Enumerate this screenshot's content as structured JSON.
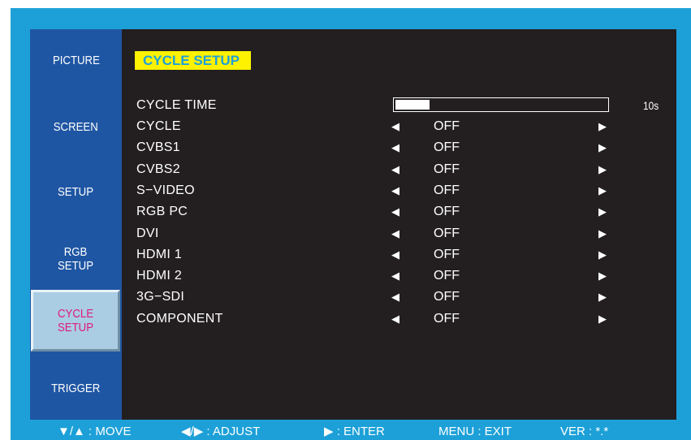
{
  "sidebar": {
    "items": [
      {
        "label": "PICTURE"
      },
      {
        "label": "SCREEN"
      },
      {
        "label": "SETUP"
      },
      {
        "label": "RGB\nSETUP"
      },
      {
        "label": "CYCLE\nSETUP",
        "active": true
      },
      {
        "label": "TRIGGER"
      }
    ]
  },
  "main": {
    "title": "CYCLE SETUP",
    "cycle_time": {
      "label": "CYCLE TIME",
      "value": "10s",
      "level_fraction": 0.16
    },
    "rows": [
      {
        "label": "CYCLE",
        "value": "OFF"
      },
      {
        "label": "CVBS1",
        "value": "OFF"
      },
      {
        "label": "CVBS2",
        "value": "OFF"
      },
      {
        "label": "S−VIDEO",
        "value": "OFF"
      },
      {
        "label": "RGB PC",
        "value": "OFF"
      },
      {
        "label": "DVI",
        "value": "OFF"
      },
      {
        "label": "HDMI 1",
        "value": "OFF"
      },
      {
        "label": "HDMI 2",
        "value": "OFF"
      },
      {
        "label": "3G−SDI",
        "value": "OFF"
      },
      {
        "label": "COMPONENT",
        "value": "OFF"
      }
    ],
    "arrow_left": "◀",
    "arrow_right": "▶"
  },
  "footer": {
    "move": "▼/▲ : MOVE",
    "adjust": "◀/▶ : ADJUST",
    "enter": "▶ : ENTER",
    "exit": "MENU : EXIT",
    "version": "VER : *.*"
  },
  "colors": {
    "frame": "#1da0d8",
    "sidebar": "#1f56a3",
    "content_bg": "#231f20",
    "title_bg": "#fff200",
    "active_item_bg": "#aacde3",
    "active_item_text": "#e0197d"
  }
}
